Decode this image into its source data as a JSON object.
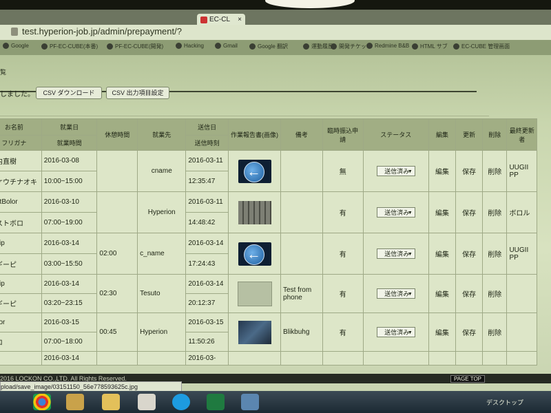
{
  "browser": {
    "tab_title": "EC-CL",
    "tab_close": "×",
    "url": "test.hyperion-job.jp/admin/prepayment/?",
    "bookmarks": [
      "Google",
      "PF-EC-CUBE(本番)",
      "PF-EC-CUBE(開発)",
      "Hacking",
      "Gmail",
      "Google 翻訳",
      "運動履歴",
      "開発チケット",
      "Redmine B&B",
      "HTML サブ",
      "EC-CUBE 管理画面"
    ]
  },
  "page": {
    "header": "覧",
    "notice": "しました。",
    "csv_download_label": "CSV ダウンロード",
    "csv_settings_label": "CSV 出力項目設定"
  },
  "table": {
    "headers": {
      "name": "お名前",
      "furigana": "フリガナ",
      "work_date": "就業日",
      "work_time": "就業時間",
      "break_time": "休憩時間",
      "company": "就業先",
      "sent_date": "送信日",
      "sent_time": "送信時刻",
      "report": "作業報告書(画像)",
      "note": "備考",
      "temp_request": "臨時振込申請",
      "status": "ステータス",
      "edit": "編集",
      "update": "更新",
      "delete": "削除",
      "last_updater": "最終更新者"
    },
    "rows": [
      {
        "name": "堀内直樹",
        "kana": "ナケウチナオキ",
        "date": "2016-03-08",
        "hours": "10:00~15:00",
        "break": "",
        "company": "cname",
        "sent_date": "2016-03-11",
        "sent_time": "12:35:47",
        "thumb": "arrow-icon",
        "note": "",
        "temp": "無",
        "status": "送信済み",
        "edit": "編集",
        "save": "保存",
        "del": "削除",
        "updater": "UUGII PP"
      },
      {
        "name": "TestBolor",
        "kana": "テストボロ",
        "date": "2016-03-10",
        "hours": "07:00~19:00",
        "break": "",
        "company": "Hyperion",
        "sent_date": "2016-03-11",
        "sent_time": "14:48:42",
        "thumb": "keyboard-photo",
        "note": "",
        "temp": "有",
        "status": "送信済み",
        "edit": "編集",
        "save": "保存",
        "del": "削除",
        "updater": "ボロル"
      },
      {
        "name": "Ugiip",
        "kana": "ウギーピ",
        "date": "2016-03-14",
        "hours": "03:00~15:50",
        "break": "02:00",
        "company": "c_name",
        "sent_date": "2016-03-14",
        "sent_time": "17:24:43",
        "thumb": "arrow-icon",
        "note": "",
        "temp": "有",
        "status": "送信済み",
        "edit": "編集",
        "save": "保存",
        "del": "削除",
        "updater": "UUGII PP"
      },
      {
        "name": "Ugiip",
        "kana": "ウギーピ",
        "date": "2016-03-14",
        "hours": "03:20~23:15",
        "break": "02:30",
        "company": "Tesuto",
        "sent_date": "2016-03-14",
        "sent_time": "20:12:37",
        "thumb": "document-photo",
        "note": "Test from phone",
        "temp": "有",
        "status": "送信済み",
        "edit": "編集",
        "save": "保存",
        "del": "削除",
        "updater": ""
      },
      {
        "name": "Bolor",
        "kana": "ボロ",
        "date": "2016-03-15",
        "hours": "07:00~18:00",
        "break": "00:45",
        "company": "Hyperion",
        "sent_date": "2016-03-15",
        "sent_time": "11:50:26",
        "thumb": "dark-photo",
        "note": "Blikbuhg",
        "temp": "有",
        "status": "送信済み",
        "edit": "編集",
        "save": "保存",
        "del": "削除",
        "updater": ""
      }
    ],
    "partial_row": {
      "date": "2016-03-14",
      "sent_date": "2016-03-"
    }
  },
  "footer": {
    "copyright": "2016 LOCKON CO.,LTD. All Rights Reserved.",
    "page_top": "PAGE TOP",
    "status_url": "pload/save_image/03151150_56e778593625c.jpg"
  },
  "taskbar": {
    "icons": [
      "chrome-icon",
      "explorer-icon",
      "folder-icon",
      "notepad-icon",
      "skype-icon",
      "excel-icon",
      "photo-icon"
    ],
    "tray_text": "デスクトップ"
  }
}
